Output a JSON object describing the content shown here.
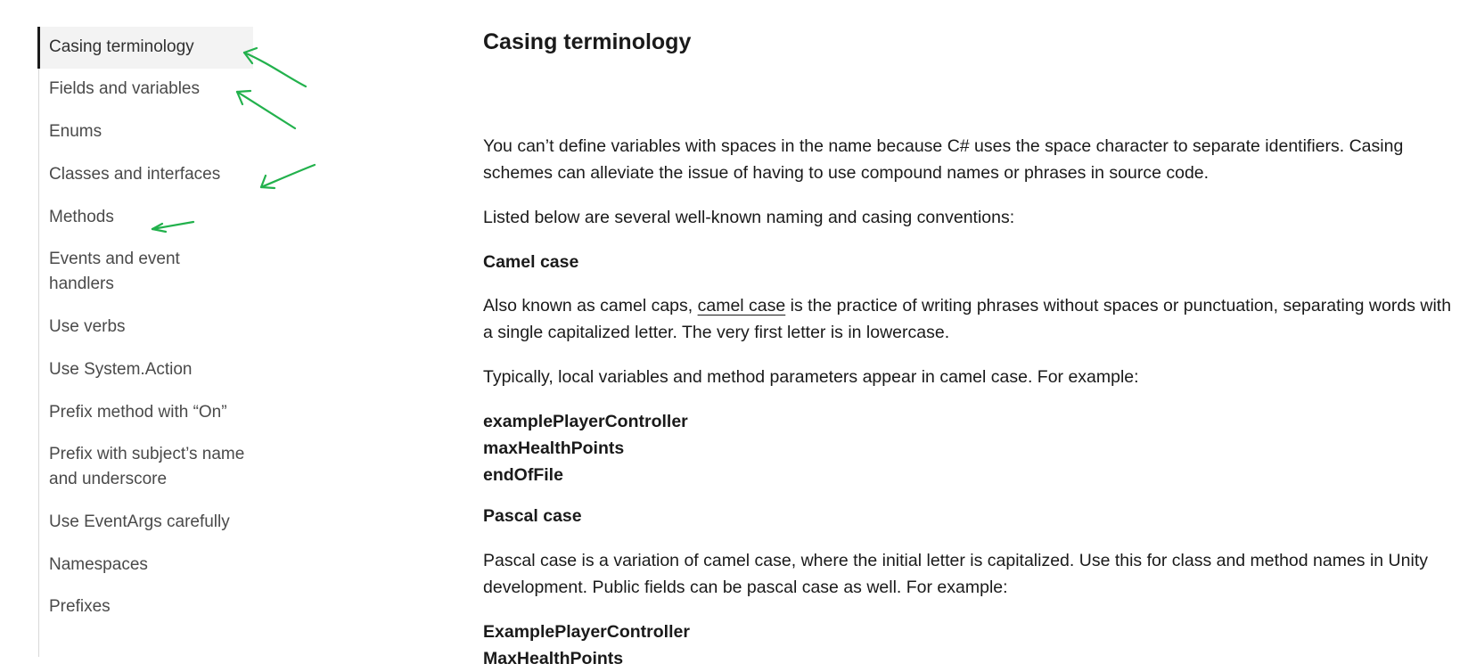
{
  "sidebar": {
    "items": [
      {
        "label": "Casing terminology",
        "active": true
      },
      {
        "label": "Fields and variables"
      },
      {
        "label": "Enums"
      },
      {
        "label": "Classes and interfaces"
      },
      {
        "label": "Methods"
      },
      {
        "label": "Events and event handlers"
      },
      {
        "label": "Use verbs"
      },
      {
        "label": "Use System.Action"
      },
      {
        "label": "Prefix method with “On”"
      },
      {
        "label": "Prefix with subject’s name and underscore"
      },
      {
        "label": "Use EventArgs carefully"
      },
      {
        "label": "Namespaces"
      },
      {
        "label": "Prefixes"
      }
    ]
  },
  "annotations": {
    "color": "#22b14c",
    "icon": "green-hand-drawn-arrow"
  },
  "article": {
    "title": "Casing terminology",
    "intro": "You can’t define variables with spaces in the name because C# uses the space character to separate identifiers. Casing schemes can alleviate the issue of having to use compound names or phrases in source code.",
    "listed": "Listed below are several well-known naming and casing conventions:",
    "camel": {
      "heading": "Camel case",
      "desc_before": "Also known as camel caps, ",
      "desc_link": "camel case",
      "desc_after": " is the practice of writing phrases without spaces or punctuation, separating words with a single capitalized letter. The very first letter is in lowercase.",
      "usage": "Typically, local variables and method parameters appear in camel case. For example:",
      "examples": [
        "examplePlayerController",
        "maxHealthPoints",
        "endOfFile"
      ]
    },
    "pascal": {
      "heading": "Pascal case",
      "desc": "Pascal case is a variation of camel case, where the initial letter is capitalized. Use this for class and method names in Unity development. Public fields can be pascal case as well. For example:",
      "examples": [
        "ExamplePlayerController",
        "MaxHealthPoints"
      ]
    }
  }
}
